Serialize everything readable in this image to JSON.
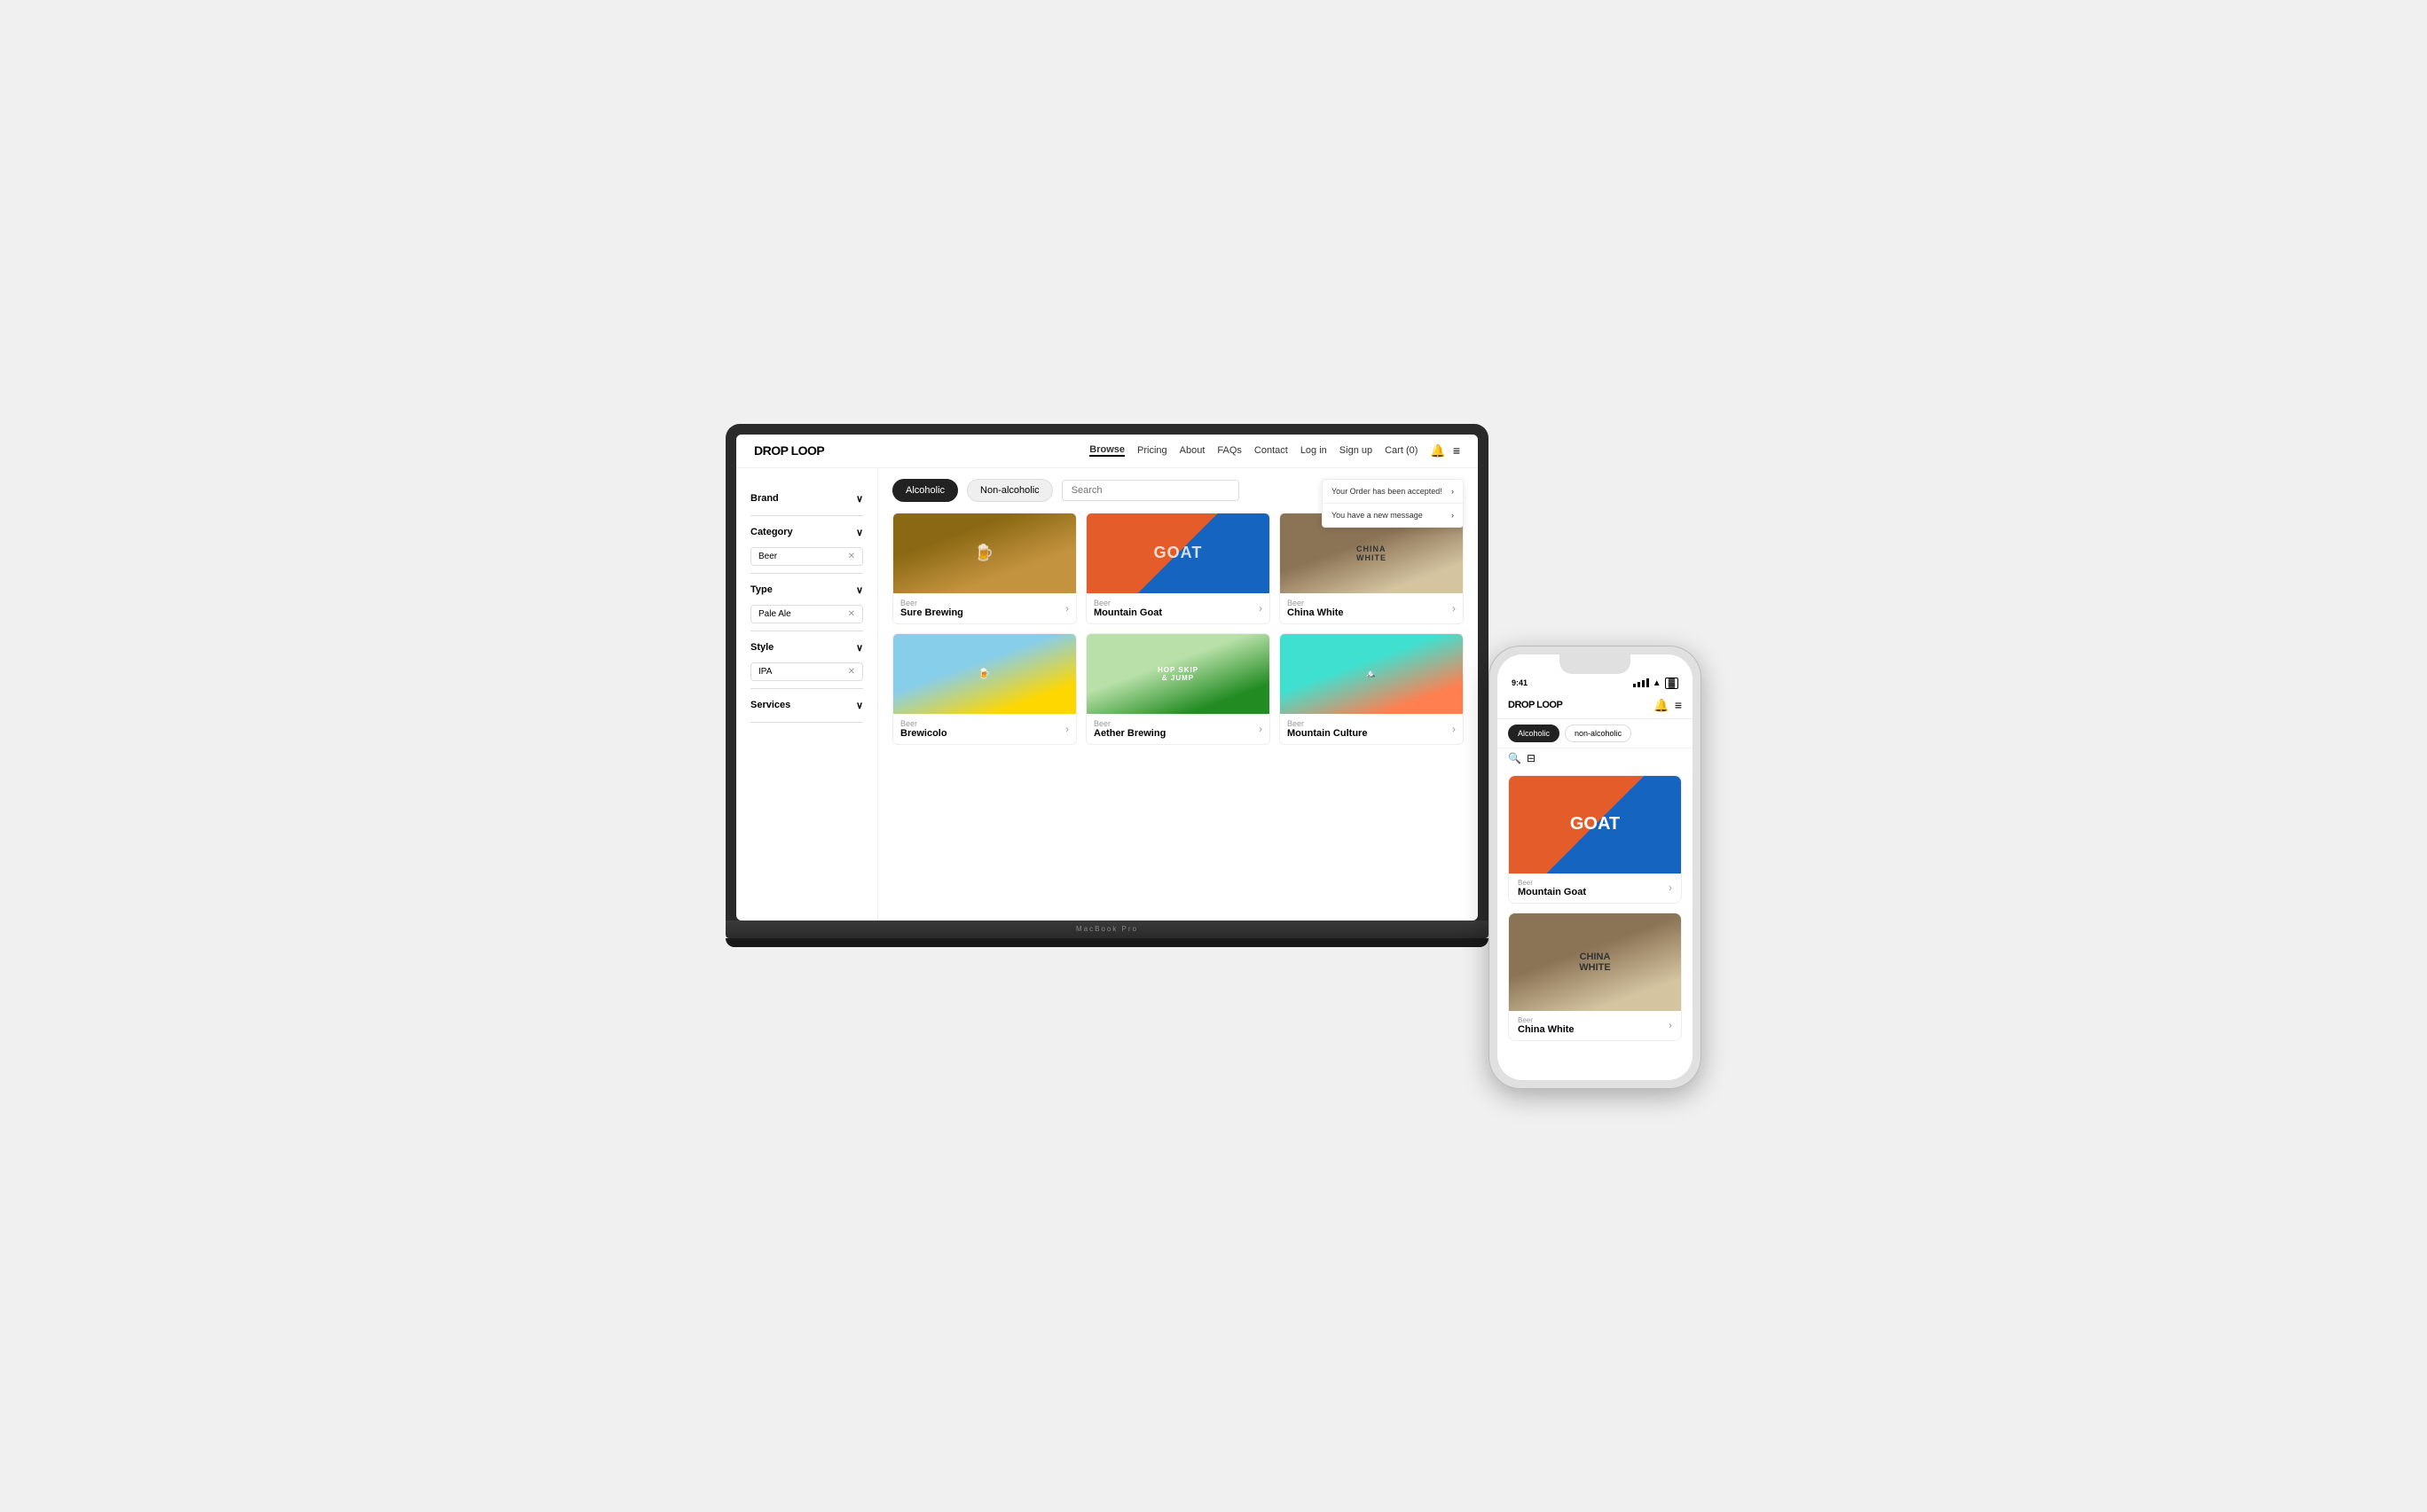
{
  "laptop": {
    "brand": "MacBook Pro"
  },
  "web": {
    "logo": "DROP LOOP",
    "nav": {
      "links": [
        {
          "label": "Browse",
          "active": true
        },
        {
          "label": "Pricing"
        },
        {
          "label": "About"
        },
        {
          "label": "FAQs"
        },
        {
          "label": "Contact"
        },
        {
          "label": "Log in"
        },
        {
          "label": "Sign up"
        },
        {
          "label": "Cart (0)"
        }
      ]
    },
    "tabs": {
      "alcoholic": "Alcoholic",
      "non_alcoholic": "Non-alcoholic"
    },
    "search_placeholder": "Search",
    "notifications": [
      {
        "text": "Your Order has been accepted!"
      },
      {
        "text": "You have a new message"
      }
    ],
    "filters": {
      "brand": {
        "label": "Brand"
      },
      "category": {
        "label": "Category"
      },
      "category_tag": "Beer",
      "type": {
        "label": "Type"
      },
      "type_tag": "Pale Ale",
      "style": {
        "label": "Style"
      },
      "style_tag": "IPA",
      "services": {
        "label": "Services"
      }
    },
    "products": [
      {
        "category": "Beer",
        "name": "Sure Brewing",
        "bg": "sure"
      },
      {
        "category": "Beer",
        "name": "Mountain Goat",
        "bg": "goat",
        "label": "GOAT"
      },
      {
        "category": "Beer",
        "name": "China White",
        "bg": "china-white"
      },
      {
        "category": "Beer",
        "name": "Brewicolo",
        "bg": "brewicolo"
      },
      {
        "category": "Beer",
        "name": "Aether Brewing",
        "bg": "aether",
        "label": "HOP SKIP JUMP"
      },
      {
        "category": "Beer",
        "name": "Mountain Culture",
        "bg": "mountain-culture"
      }
    ]
  },
  "mobile": {
    "logo": "DROP LOOP",
    "status": {
      "time": "9:41"
    },
    "tabs": {
      "alcoholic": "Alcoholic",
      "non_alcoholic": "non-alcoholic"
    },
    "products": [
      {
        "category": "Beer",
        "name": "Mountain Goat",
        "bg": "goat",
        "label": "GOAT"
      },
      {
        "category": "Beer",
        "name": "China White",
        "bg": "china-white"
      }
    ]
  }
}
